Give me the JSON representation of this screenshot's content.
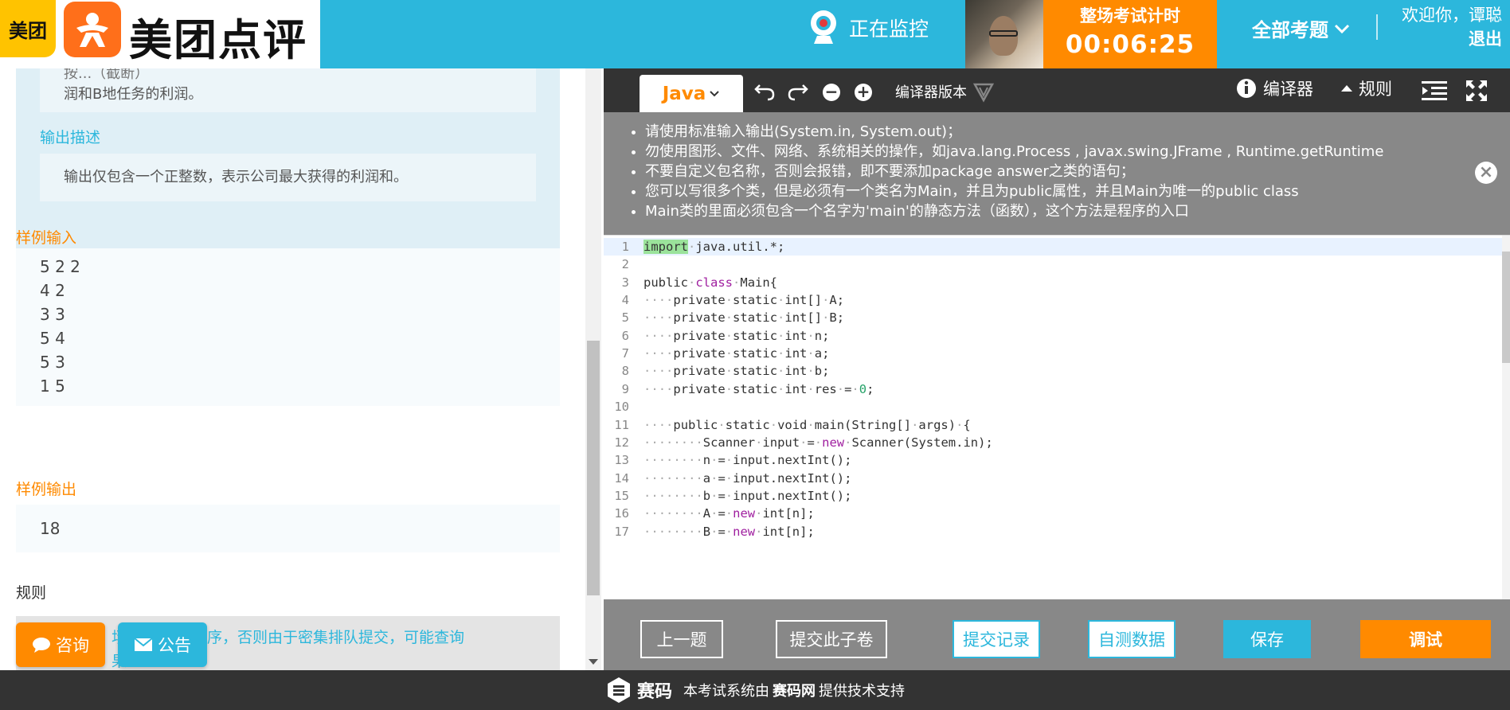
{
  "header": {
    "logo_small": "美团",
    "logo_text": "美团点评",
    "monitor_label": "正在监控",
    "timer_label": "整场考试计时",
    "timer_value": "00:06:25",
    "all_questions": "全部考题",
    "welcome": "欢迎你，谭聪",
    "logout": "退出"
  },
  "problem": {
    "desc_top_line1": "按...（截断）",
    "desc_top_line2": "润和B地任务的利润。",
    "output_heading": "输出描述",
    "output_text": "输出仅包含一个正整数，表示公司最大获得的利润和。",
    "sample_input_label": "样例输入",
    "sample_input_lines": [
      "5 2 2",
      "4 2",
      "3 3",
      "5 4",
      "5 3",
      "1 5"
    ],
    "sample_output_label": "样例输出",
    "sample_output": "18",
    "rules_label": "规则",
    "rules_text_line1": "场 钟前调试程序，否则由于密集排队提交，可能查询",
    "rules_text_line2": "果"
  },
  "floating": {
    "consult": "咨询",
    "notice": "公告"
  },
  "toolbar": {
    "language": "Java",
    "compiler_version": "编译器版本",
    "compiler": "编译器",
    "rules": "规则"
  },
  "notice": {
    "items": [
      "请使用标准输入输出(System.in, System.out)；",
      "勿使用图形、文件、网络、系统相关的操作，如java.lang.Process , javax.swing.JFrame , Runtime.getRuntime",
      "不要自定义包名称，否则会报错，即不要添加package answer之类的语句；",
      "您可以写很多个类，但是必须有一个类名为Main，并且为public属性，并且Main为唯一的public class",
      "Main类的里面必须包含一个名字为'main'的静态方法（函数），这个方法是程序的入口"
    ],
    "close": "×"
  },
  "code": {
    "lines": [
      {
        "no": "1",
        "text": "import·java.util.*;"
      },
      {
        "no": "2",
        "text": ""
      },
      {
        "no": "3",
        "text": "public·class·Main{"
      },
      {
        "no": "4",
        "text": "····private·static·int[]·A;"
      },
      {
        "no": "5",
        "text": "····private·static·int[]·B;"
      },
      {
        "no": "6",
        "text": "····private·static·int·n;"
      },
      {
        "no": "7",
        "text": "····private·static·int·a;"
      },
      {
        "no": "8",
        "text": "····private·static·int·b;"
      },
      {
        "no": "9",
        "text": "····private·static·int·res·=·0;"
      },
      {
        "no": "10",
        "text": ""
      },
      {
        "no": "11",
        "text": "····public·static·void·main(String[]·args)·{"
      },
      {
        "no": "12",
        "text": "········Scanner·input·=·new·Scanner(System.in);"
      },
      {
        "no": "13",
        "text": "········n·=·input.nextInt();"
      },
      {
        "no": "14",
        "text": "········a·=·input.nextInt();"
      },
      {
        "no": "15",
        "text": "········b·=·input.nextInt();"
      },
      {
        "no": "16",
        "text": "········A·=·new·int[n];"
      },
      {
        "no": "17",
        "text": "········B·=·new·int[n];"
      }
    ]
  },
  "actions": {
    "prev": "上一题",
    "submit_paper": "提交此子卷",
    "submit_history": "提交记录",
    "self_test": "自测数据",
    "save": "保存",
    "debug": "调试"
  },
  "footer": {
    "logo": "赛码",
    "text_before": "本考试系统由",
    "brand": "赛码网",
    "text_after": "提供技术支持"
  },
  "colors": {
    "brand_blue": "#2cb7dc",
    "accent_orange": "#ff8a00",
    "dark": "#333333",
    "gray": "#888888"
  }
}
